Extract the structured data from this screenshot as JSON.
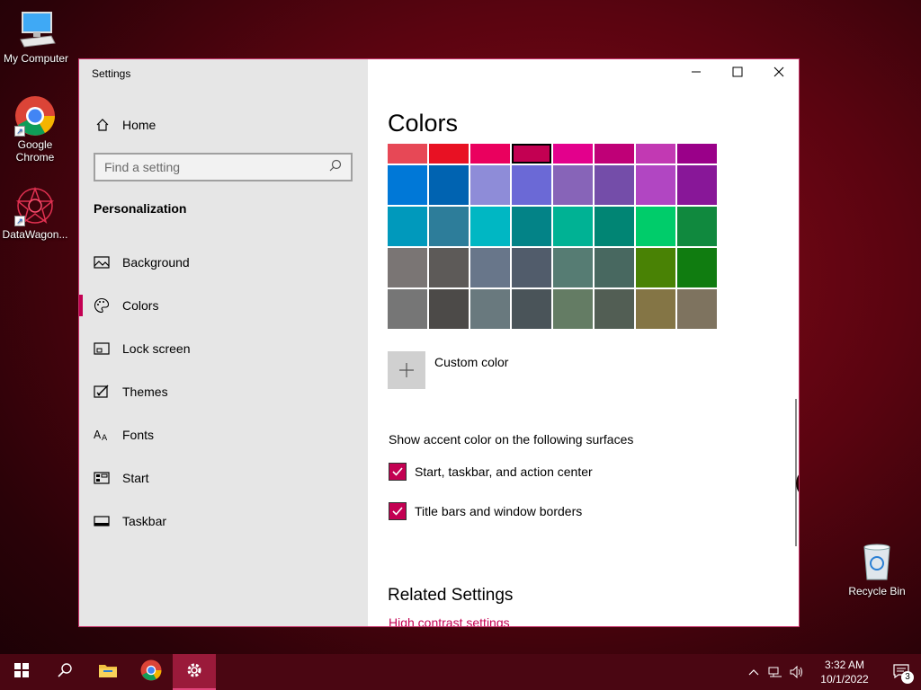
{
  "desktop": {
    "icons": [
      {
        "label": "My Computer"
      },
      {
        "label": "Google Chrome"
      },
      {
        "label": "DataWagon..."
      }
    ],
    "recycle_bin": {
      "label": "Recycle Bin"
    }
  },
  "window": {
    "title": "Settings",
    "controls": {
      "minimize": "minimize-icon",
      "maximize": "maximize-icon",
      "close": "close-icon"
    }
  },
  "sidebar": {
    "home_label": "Home",
    "search": {
      "placeholder": "Find a setting"
    },
    "section_title": "Personalization",
    "items": [
      {
        "label": "Background",
        "icon": "picture-icon"
      },
      {
        "label": "Colors",
        "icon": "palette-icon",
        "active": true
      },
      {
        "label": "Lock screen",
        "icon": "lock-screen-icon"
      },
      {
        "label": "Themes",
        "icon": "themes-icon"
      },
      {
        "label": "Fonts",
        "icon": "fonts-icon"
      },
      {
        "label": "Start",
        "icon": "start-icon"
      },
      {
        "label": "Taskbar",
        "icon": "taskbar-icon"
      }
    ]
  },
  "content": {
    "title": "Colors",
    "swatch_rows": [
      [
        "#e74856",
        "#e81123",
        "#ea005e",
        "#c30052",
        "#e3008c",
        "#bf0077",
        "#c239b3",
        "#9a0089"
      ],
      [
        "#0078d7",
        "#0063b1",
        "#8e8cd8",
        "#6b69d6",
        "#8764b8",
        "#744da9",
        "#b146c2",
        "#881798"
      ],
      [
        "#0099bc",
        "#2d7d9a",
        "#00b7c3",
        "#038387",
        "#00b294",
        "#018574",
        "#00cc6a",
        "#10893e"
      ],
      [
        "#7a7574",
        "#5d5a58",
        "#68768a",
        "#515c6b",
        "#567c73",
        "#486860",
        "#498205",
        "#107c10"
      ],
      [
        "#767676",
        "#4c4a48",
        "#69797e",
        "#4a5459",
        "#647c64",
        "#525e54",
        "#847545",
        "#7e735f"
      ]
    ],
    "selected_swatch": "#c30052",
    "custom_color_label": "Custom color",
    "surfaces_label": "Show accent color on the following surfaces",
    "checkbox_start": {
      "label": "Start, taskbar, and action center",
      "checked": true
    },
    "checkbox_title_bars": {
      "label": "Title bars and window borders",
      "checked": true
    },
    "related_title": "Related Settings",
    "related_link": "High contrast settings"
  },
  "taskbar": {
    "buttons": [
      "windows-start-icon",
      "search-icon",
      "file-explorer-icon",
      "chrome-icon",
      "settings-gear-icon"
    ],
    "clock_time": "3:32 AM",
    "clock_date": "10/1/2022",
    "notification_count": "3"
  },
  "colors": {
    "accent": "#c30052",
    "taskbar": "#4a0612",
    "window_border": "#c8336a"
  }
}
